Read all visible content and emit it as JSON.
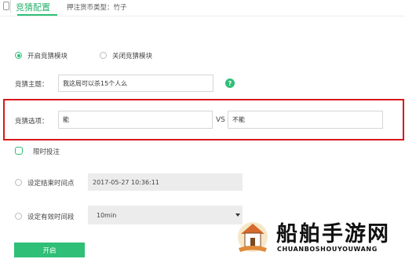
{
  "header": {
    "active_tab": "竞猜配置",
    "info": "押注货币类型：竹子"
  },
  "mode_options": {
    "enable_label": "开启竞猜模块",
    "disable_label": "关闭竞猜模块",
    "selected": "enable"
  },
  "topic": {
    "label": "竞猜主题：",
    "value": "我这局可以杀15个人么"
  },
  "options": {
    "label": "竞猜选项：",
    "option_a": "能",
    "vs_label": "VS",
    "option_b": "不能"
  },
  "time_limit": {
    "checkbox_label": "限时投注",
    "end_time_label": "设定结束时间点",
    "end_time_value": "2017-05-27 10:36:11",
    "duration_label": "设定有效时间段",
    "duration_value": "10min"
  },
  "submit_label": "开启",
  "watermark": {
    "title": "船舶手游网",
    "subtitle": "CHUANBOSHOUYOUWANG"
  },
  "colors": {
    "accent": "#2fbf76",
    "highlight": "#d7191c"
  }
}
